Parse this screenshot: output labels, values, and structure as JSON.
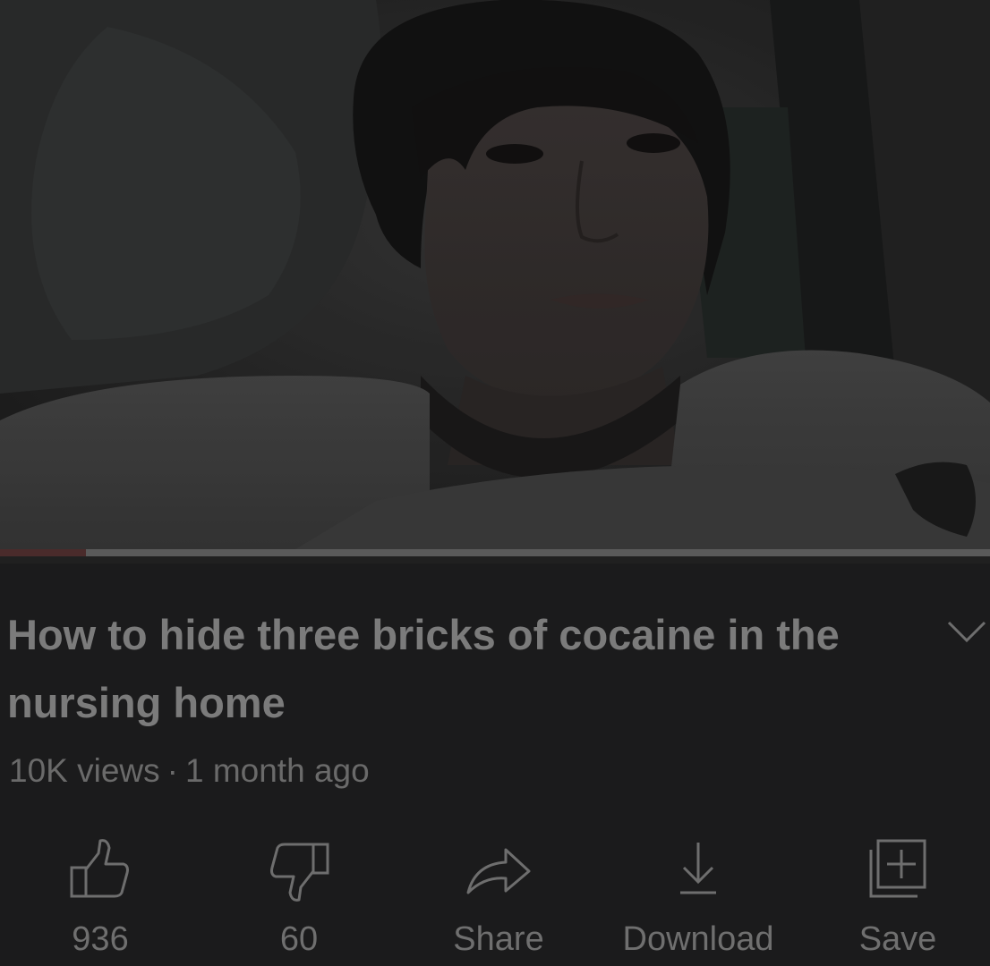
{
  "video": {
    "title": "How to hide three bricks of cocaine in the nursing home",
    "views": "10K views",
    "separator": "·",
    "age": "1 month ago",
    "progress": 0.087,
    "buffered": 1.0
  },
  "actions": [
    {
      "id": "like",
      "icon": "thumbs-up-icon",
      "label": "936"
    },
    {
      "id": "dislike",
      "icon": "thumbs-down-icon",
      "label": "60"
    },
    {
      "id": "share",
      "icon": "share-arrow-icon",
      "label": "Share"
    },
    {
      "id": "download",
      "icon": "download-icon",
      "label": "Download"
    },
    {
      "id": "save",
      "icon": "playlist-add-icon",
      "label": "Save"
    }
  ],
  "colors": {
    "background": "#1b1b1c",
    "text": "#7b7b7b",
    "progress": "#4a2b2b"
  }
}
